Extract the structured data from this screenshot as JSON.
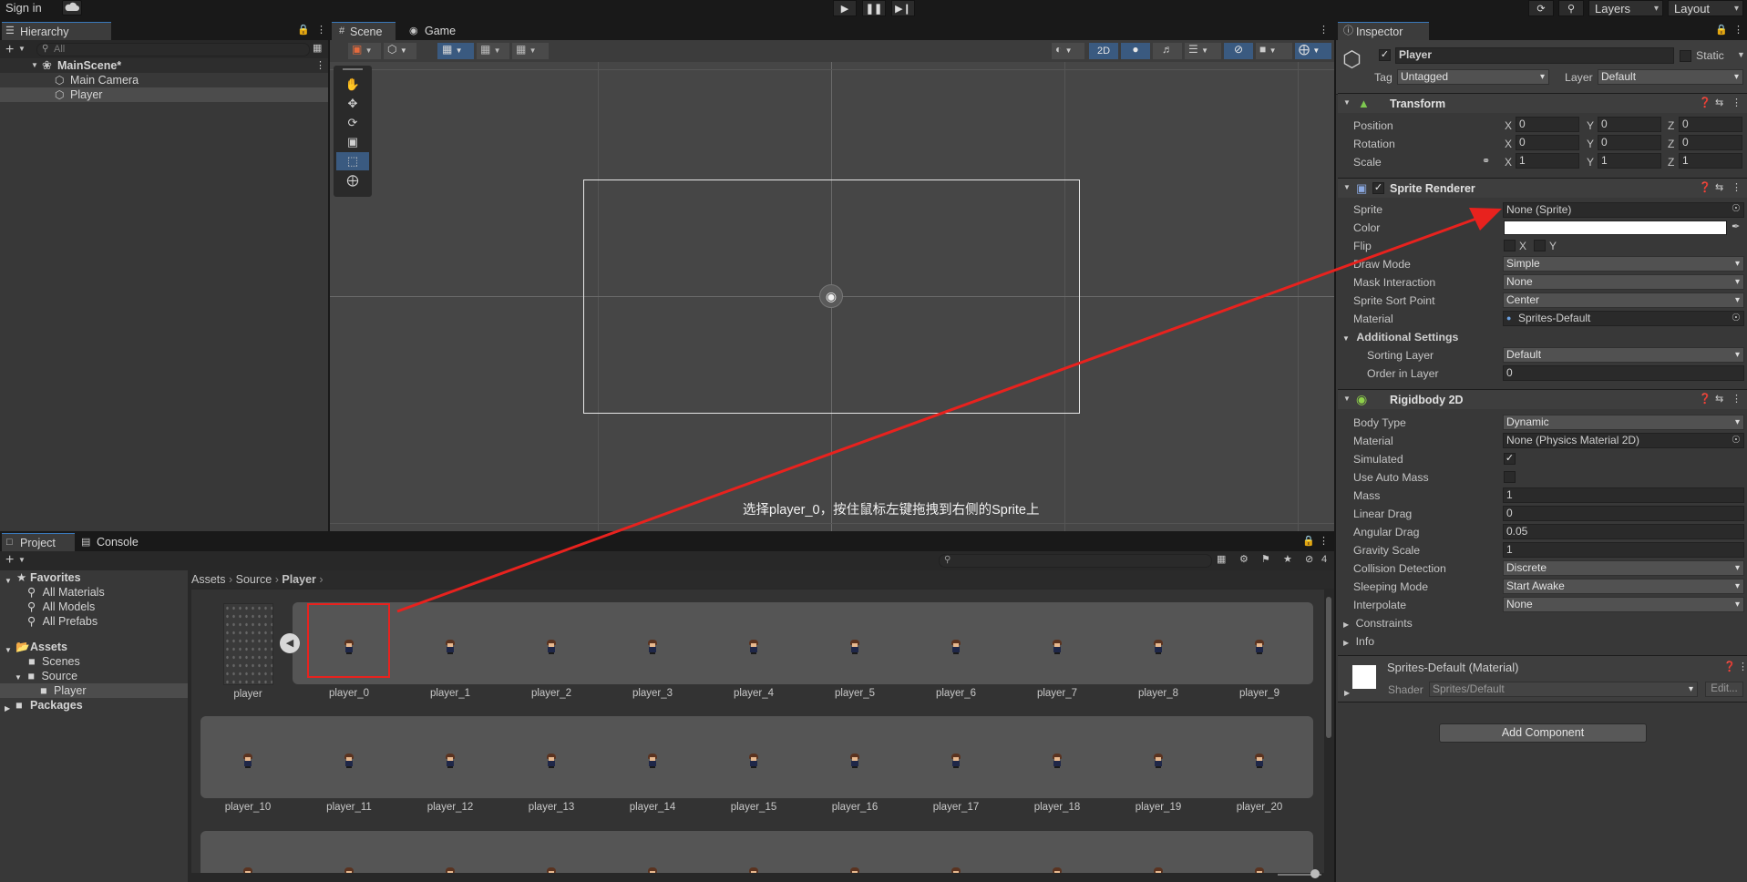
{
  "topbar": {
    "sign_in": "Sign in",
    "play_icon": "play-icon",
    "pause_icon": "pause-icon",
    "step_icon": "step-icon",
    "layers_label": "Layers",
    "layout_label": "Layout"
  },
  "hierarchy": {
    "tab": "Hierarchy",
    "search_placeholder": "All",
    "scene": "MainScene*",
    "items": [
      "Main Camera",
      "Player"
    ]
  },
  "scene": {
    "tab_scene": "Scene",
    "tab_game": "Game",
    "mode_2d": "2D",
    "annotation": "选择player_0，按住鼠标左键拖拽到右侧的Sprite上"
  },
  "inspector": {
    "tab": "Inspector",
    "object_name": "Player",
    "static_label": "Static",
    "tag_label": "Tag",
    "tag_value": "Untagged",
    "layer_label": "Layer",
    "layer_value": "Default",
    "transform": {
      "title": "Transform",
      "position_label": "Position",
      "rotation_label": "Rotation",
      "scale_label": "Scale",
      "position": [
        "0",
        "0",
        "0"
      ],
      "rotation": [
        "0",
        "0",
        "0"
      ],
      "scale": [
        "1",
        "1",
        "1"
      ]
    },
    "sprite_renderer": {
      "title": "Sprite Renderer",
      "sprite_label": "Sprite",
      "sprite_value": "None (Sprite)",
      "color_label": "Color",
      "color_value": "#ffffff",
      "flip_label": "Flip",
      "flip_x": "X",
      "flip_y": "Y",
      "draw_mode_label": "Draw Mode",
      "draw_mode_value": "Simple",
      "mask_label": "Mask Interaction",
      "mask_value": "None",
      "sort_point_label": "Sprite Sort Point",
      "sort_point_value": "Center",
      "material_label": "Material",
      "material_value": "Sprites-Default",
      "additional": "Additional Settings",
      "sorting_layer_label": "Sorting Layer",
      "sorting_layer_value": "Default",
      "order_label": "Order in Layer",
      "order_value": "0"
    },
    "rigidbody": {
      "title": "Rigidbody 2D",
      "body_type_label": "Body Type",
      "body_type_value": "Dynamic",
      "material_label": "Material",
      "material_value": "None (Physics Material 2D)",
      "simulated_label": "Simulated",
      "auto_mass_label": "Use Auto Mass",
      "mass_label": "Mass",
      "mass_value": "1",
      "linear_drag_label": "Linear Drag",
      "linear_drag_value": "0",
      "angular_drag_label": "Angular Drag",
      "angular_drag_value": "0.05",
      "gravity_label": "Gravity Scale",
      "gravity_value": "1",
      "collision_label": "Collision Detection",
      "collision_value": "Discrete",
      "sleeping_label": "Sleeping Mode",
      "sleeping_value": "Start Awake",
      "interpolate_label": "Interpolate",
      "interpolate_value": "None",
      "constraints": "Constraints",
      "info": "Info"
    },
    "material_section": {
      "title": "Sprites-Default (Material)",
      "shader_label": "Shader",
      "shader_value": "Sprites/Default",
      "edit": "Edit..."
    },
    "add_component": "Add Component"
  },
  "project": {
    "tab_project": "Project",
    "tab_console": "Console",
    "hidden_count": "4",
    "favorites": "Favorites",
    "fav_items": [
      "All Materials",
      "All Models",
      "All Prefabs"
    ],
    "assets": "Assets",
    "asset_items": [
      "Scenes",
      "Source",
      "Player"
    ],
    "packages": "Packages",
    "breadcrumb": [
      "Assets",
      "Source",
      "Player"
    ],
    "sheet_name": "player",
    "row1": [
      "player_0",
      "player_1",
      "player_2",
      "player_3",
      "player_4",
      "player_5",
      "player_6",
      "player_7",
      "player_8",
      "player_9"
    ],
    "row2": [
      "player_10",
      "player_11",
      "player_12",
      "player_13",
      "player_14",
      "player_15",
      "player_16",
      "player_17",
      "player_18",
      "player_19",
      "player_20"
    ]
  },
  "colors": {
    "highlight_box": "#e8221e",
    "arrow": "#e8221e",
    "accent_blue": "#3a79bb"
  }
}
